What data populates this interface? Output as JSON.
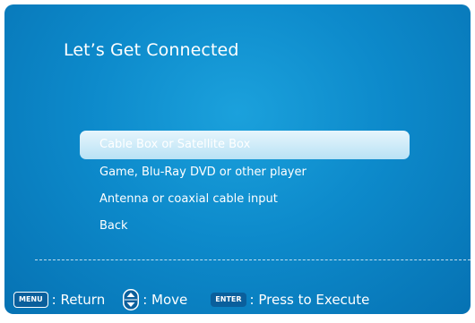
{
  "header": {
    "title": "Let’s Get Connected"
  },
  "menu": {
    "items": [
      {
        "label": "Cable Box or Satellite Box",
        "selected": true
      },
      {
        "label": "Game, Blu-Ray DVD or other player",
        "selected": false
      },
      {
        "label": "Antenna or coaxial cable input",
        "selected": false
      },
      {
        "label": "Back",
        "selected": false
      }
    ]
  },
  "footer": {
    "menu_key": "MENU",
    "menu_action": ": Return",
    "move_icon": "up-down-arrows-icon",
    "move_action": ": Move",
    "enter_key": "ENTER",
    "enter_action": ": Press to Execute"
  },
  "colors": {
    "background": "#0d8acb",
    "highlight": "#cdeaf8",
    "text": "#ffffff"
  }
}
